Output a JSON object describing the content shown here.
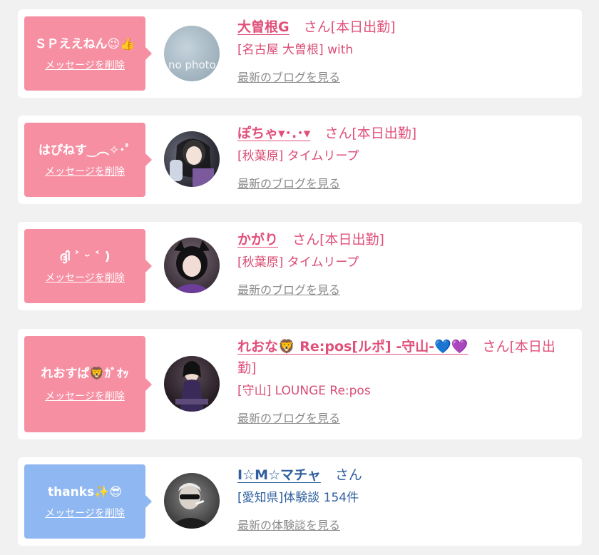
{
  "delete_label": "メッセージを削除",
  "items": [
    {
      "message": "ＳＰええねん😉👍",
      "name": "大曽根G",
      "suffix": "さん[本日出勤]",
      "sub": "[名古屋 大曽根] with",
      "blog_link": "最新のブログを見る",
      "bubble_color": "#f78fa3"
    },
    {
      "message": "はぴねす‿︵✧･ﾟ",
      "name": "ぽちゃ▾･.･▾",
      "suffix": "さん[本日出勤]",
      "sub": "[秋葉原] タイムリープ",
      "blog_link": "最新のブログを見る",
      "bubble_color": "#f78fa3"
    },
    {
      "message": "ദ്ദി ˃ ᵕ ˂ )",
      "name": "かがり",
      "suffix": "さん[本日出勤]",
      "sub": "[秋葉原] タイムリープ",
      "blog_link": "最新のブログを見る",
      "bubble_color": "#f78fa3"
    },
    {
      "message": "れおすぱ🦁ｶﾞｵｯ",
      "name": "れおな🦁 Re:pos[ルポ] -守山-💙💜",
      "suffix": "さん[本日出勤]",
      "sub": "[守山] LOUNGE Re:pos",
      "blog_link": "最新のブログを見る",
      "bubble_color": "#f78fa3"
    },
    {
      "message": "thanks✨😎",
      "name": "I☆M☆マチャ",
      "suffix": "さん",
      "sub": "[愛知県]体験談 154件",
      "blog_link": "最新の体験談を見る",
      "bubble_color": "#8fb7f2"
    }
  ]
}
